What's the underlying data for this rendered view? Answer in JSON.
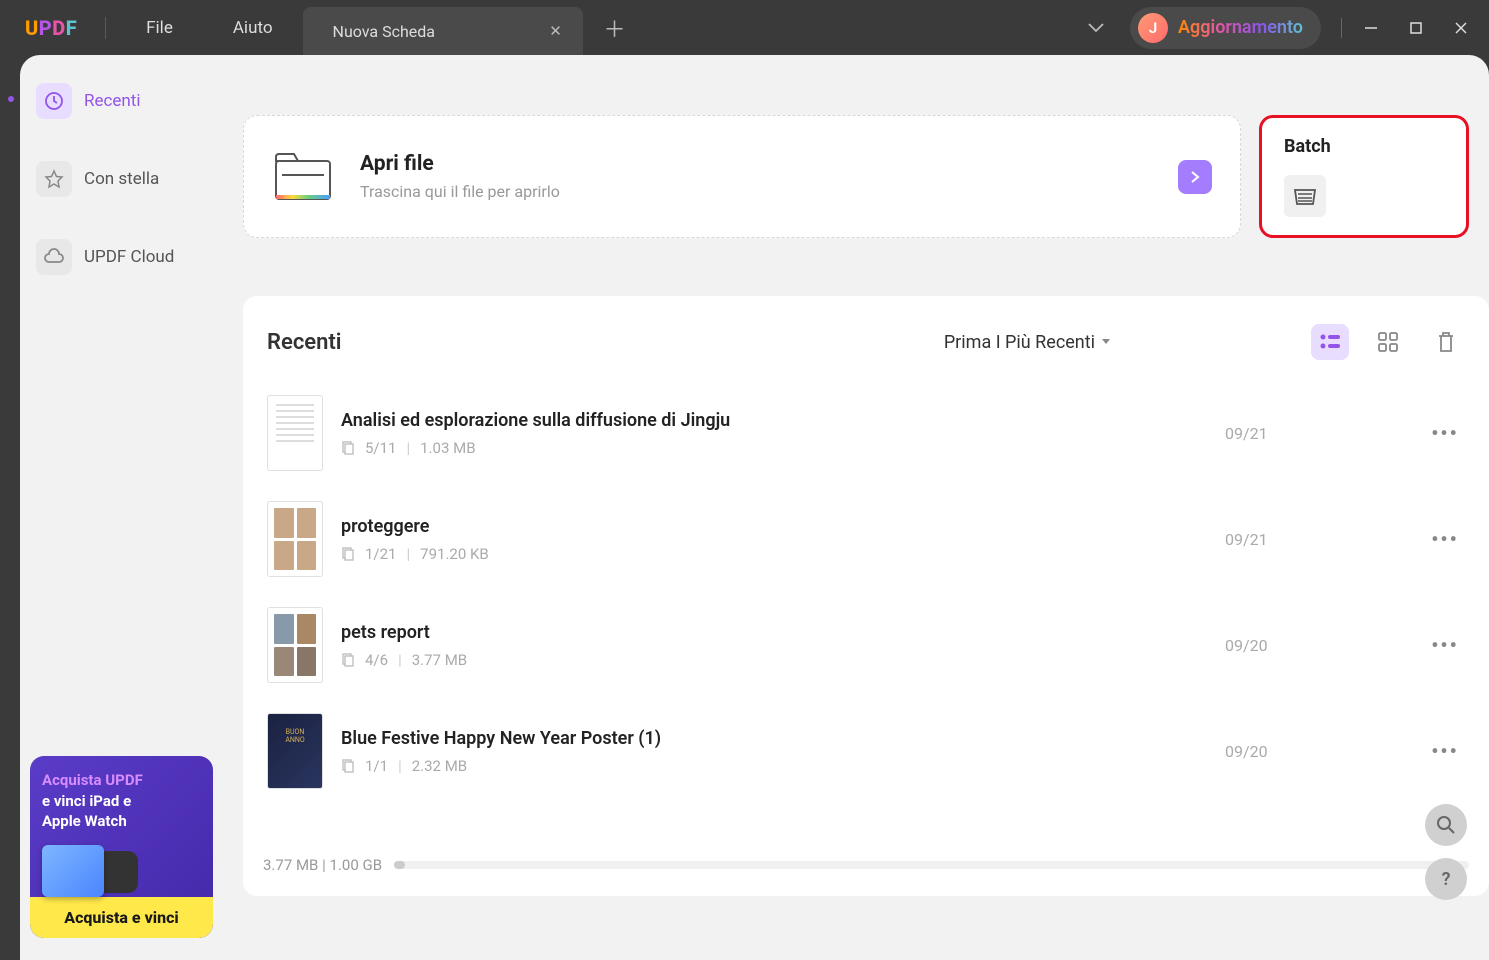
{
  "titlebar": {
    "menu_file": "File",
    "menu_help": "Aiuto",
    "tab_label": "Nuova Scheda",
    "avatar_initial": "J",
    "upgrade_label": "Aggiornamento"
  },
  "sidebar": {
    "recent": "Recenti",
    "starred": "Con stella",
    "cloud": "UPDF Cloud"
  },
  "promo": {
    "line1": "Acquista UPDF",
    "line2": "e vinci iPad e",
    "line3": "Apple Watch",
    "cta": "Acquista e vinci"
  },
  "open_card": {
    "title": "Apri file",
    "subtitle": "Trascina qui il file per aprirlo"
  },
  "batch": {
    "title": "Batch"
  },
  "recent_section": {
    "title": "Recenti",
    "sort": "Prima I Più Recenti"
  },
  "files": [
    {
      "name": "Analisi ed esplorazione sulla diffusione di Jingju",
      "pages": "5/11",
      "size": "1.03 MB",
      "date": "09/21"
    },
    {
      "name": "proteggere",
      "pages": "1/21",
      "size": "791.20 KB",
      "date": "09/21"
    },
    {
      "name": "pets report",
      "pages": "4/6",
      "size": "3.77 MB",
      "date": "09/20"
    },
    {
      "name": "Blue Festive Happy New Year Poster (1)",
      "pages": "1/1",
      "size": "2.32 MB",
      "date": "09/20"
    }
  ],
  "footer": {
    "storage": "3.77 MB | 1.00 GB"
  }
}
